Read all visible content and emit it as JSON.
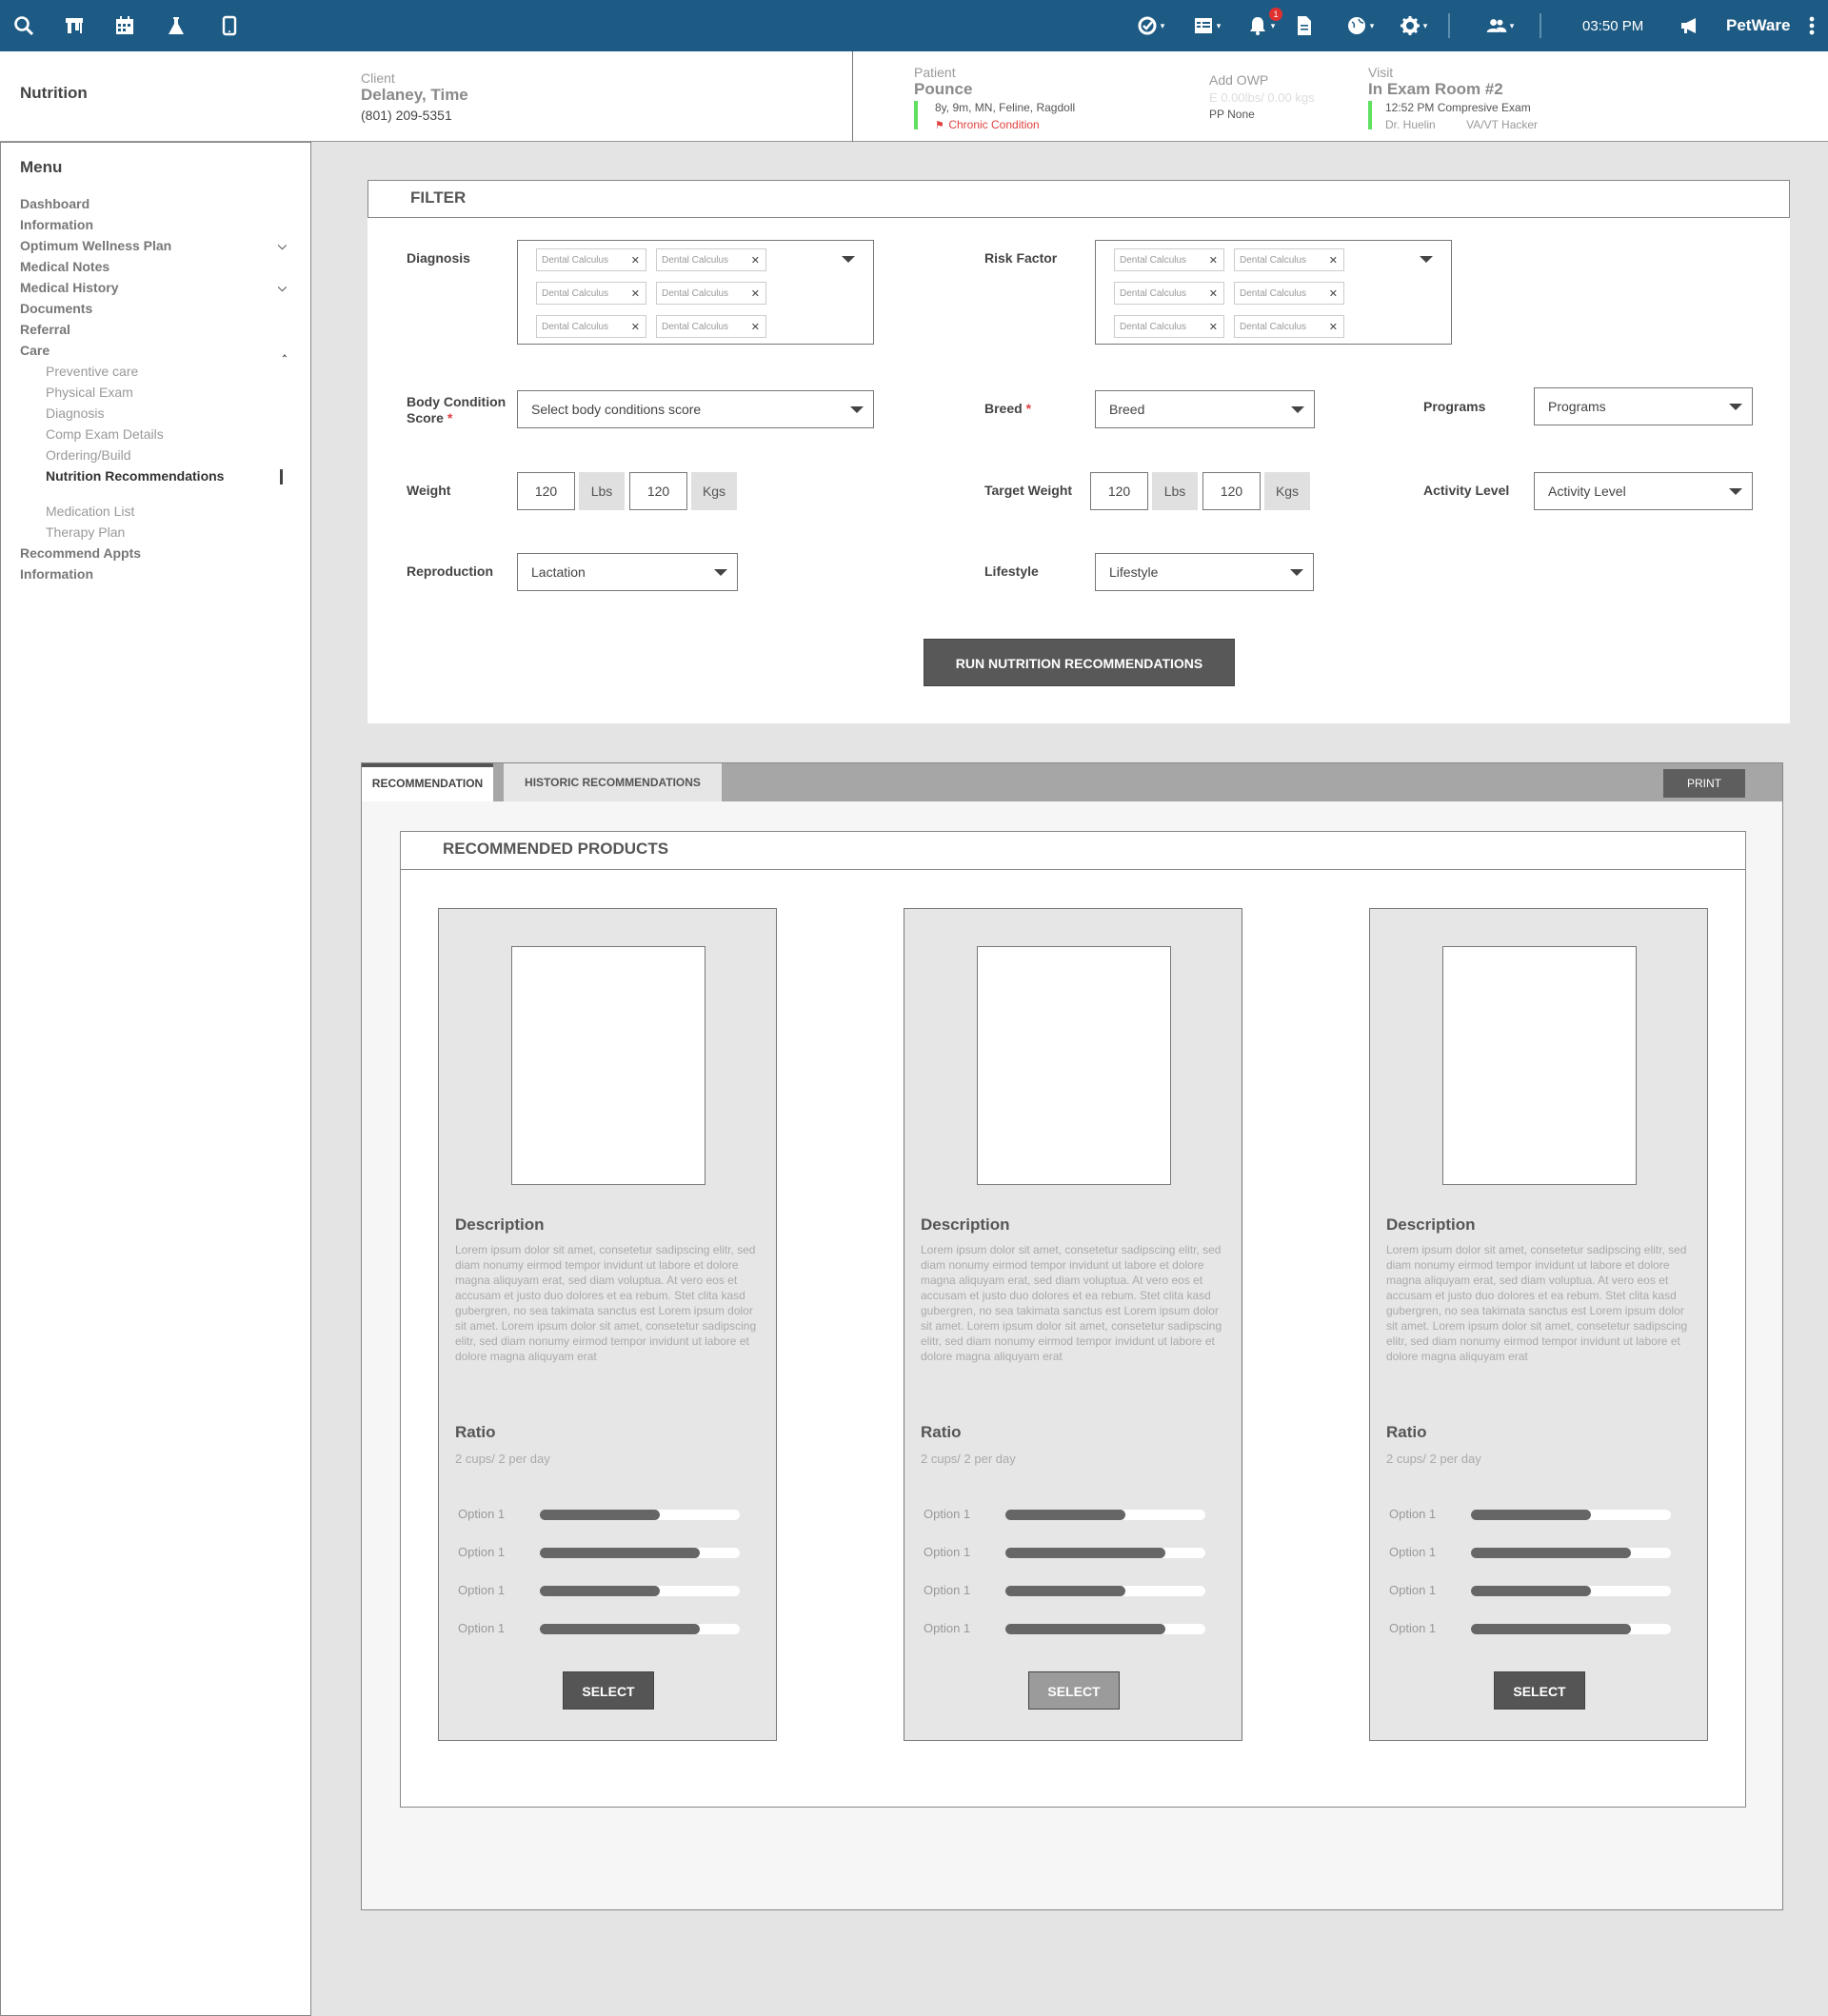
{
  "topbar": {
    "time": "03:50 PM",
    "brand": "PetWare",
    "notification_count": "1"
  },
  "header": {
    "page_title": "Nutrition",
    "client": {
      "label": "Client",
      "name": "Delaney, Time",
      "phone": "(801) 209-5351"
    },
    "patient": {
      "label": "Patient",
      "name": "Pounce",
      "details": "8y, 9m, MN, Feline, Ragdoll",
      "condition": "Chronic Condition"
    },
    "owp": {
      "label": "Add OWP",
      "weight": "E 0.00lbs/ 0.00 kgs",
      "pp": "PP None"
    },
    "visit": {
      "label": "Visit",
      "room": "In Exam Room #2",
      "exam": "12:52 PM Compresive Exam",
      "doctor": "Dr. Huelin",
      "tech": "VA/VT Hacker"
    }
  },
  "sidebar": {
    "title": "Menu",
    "items": [
      {
        "label": "Dashboard"
      },
      {
        "label": "Information"
      },
      {
        "label": "Optimum Wellness Plan"
      },
      {
        "label": "Medical Notes"
      },
      {
        "label": "Medical History"
      },
      {
        "label": "Documents"
      },
      {
        "label": "Referral"
      },
      {
        "label": "Care"
      },
      {
        "label": "Preventive care"
      },
      {
        "label": "Physical Exam"
      },
      {
        "label": "Diagnosis"
      },
      {
        "label": "Comp Exam Details"
      },
      {
        "label": "Ordering/Build"
      },
      {
        "label": "Nutrition Recommendations"
      },
      {
        "label": "Medication List"
      },
      {
        "label": "Therapy Plan"
      },
      {
        "label": "Recommend Appts"
      },
      {
        "label": "Information"
      }
    ]
  },
  "filter": {
    "title": "FILTER",
    "diagnosis": {
      "label": "Diagnosis",
      "tags": [
        "Dental Calculus",
        "Dental Calculus",
        "Dental Calculus",
        "Dental Calculus",
        "Dental Calculus",
        "Dental Calculus"
      ]
    },
    "risk_factor": {
      "label": "Risk Factor",
      "tags": [
        "Dental Calculus",
        "Dental Calculus",
        "Dental Calculus",
        "Dental Calculus",
        "Dental Calculus",
        "Dental Calculus"
      ]
    },
    "body_condition": {
      "label_line1": "Body Condition",
      "label_line2": "Score",
      "placeholder": "Select body conditions score"
    },
    "breed": {
      "label": "Breed",
      "value": "Breed"
    },
    "programs": {
      "label": "Programs",
      "value": "Programs"
    },
    "weight": {
      "label": "Weight",
      "lbs": "120",
      "lbs_unit": "Lbs",
      "kgs": "120",
      "kgs_unit": "Kgs"
    },
    "target_weight": {
      "label": "Target Weight",
      "lbs": "120",
      "lbs_unit": "Lbs",
      "kgs": "120",
      "kgs_unit": "Kgs"
    },
    "activity_level": {
      "label": "Activity Level",
      "value": "Activity Level"
    },
    "reproduction": {
      "label": "Reproduction",
      "value": "Lactation"
    },
    "lifestyle": {
      "label": "Lifestyle",
      "value": "Lifestyle"
    },
    "run_button": "RUN NUTRITION RECOMMENDATIONS"
  },
  "recommendations": {
    "tabs": [
      "RECOMMENDATION",
      "HISTORIC RECOMMENDATIONS"
    ],
    "print_label": "PRINT",
    "section_title": "RECOMMENDED PRODUCTS",
    "products": [
      {
        "description_title": "Description",
        "description": "Lorem ipsum dolor sit amet, consetetur sadipscing elitr, sed diam nonumy eirmod tempor invidunt ut labore et dolore magna aliquyam erat, sed diam voluptua. At vero eos et accusam et justo duo dolores et ea rebum. Stet clita kasd gubergren, no sea takimata sanctus est Lorem ipsum dolor sit amet. Lorem ipsum dolor sit amet, consetetur sadipscing elitr, sed diam nonumy eirmod tempor invidunt ut labore et dolore magna aliquyam erat",
        "ratio_title": "Ratio",
        "ratio": "2 cups/ 2 per day",
        "options": [
          {
            "label": "Option 1",
            "level": 0.6
          },
          {
            "label": "Option 1",
            "level": 0.8
          },
          {
            "label": "Option 1",
            "level": 0.6
          },
          {
            "label": "Option 1",
            "level": 0.8
          }
        ],
        "select_label": "SELECT",
        "select_color": "#555555"
      },
      {
        "description_title": "Description",
        "description": "Lorem ipsum dolor sit amet, consetetur sadipscing elitr, sed diam nonumy eirmod tempor invidunt ut labore et dolore magna aliquyam erat, sed diam voluptua. At vero eos et accusam et justo duo dolores et ea rebum. Stet clita kasd gubergren, no sea takimata sanctus est Lorem ipsum dolor sit amet. Lorem ipsum dolor sit amet, consetetur sadipscing elitr, sed diam nonumy eirmod tempor invidunt ut labore et dolore magna aliquyam erat",
        "ratio_title": "Ratio",
        "ratio": "2 cups/ 2 per day",
        "options": [
          {
            "label": "Option 1",
            "level": 0.6
          },
          {
            "label": "Option 1",
            "level": 0.8
          },
          {
            "label": "Option 1",
            "level": 0.6
          },
          {
            "label": "Option 1",
            "level": 0.8
          }
        ],
        "select_label": "SELECT",
        "select_color": "#9b9b9b"
      },
      {
        "description_title": "Description",
        "description": "Lorem ipsum dolor sit amet, consetetur sadipscing elitr, sed diam nonumy eirmod tempor invidunt ut labore et dolore magna aliquyam erat, sed diam voluptua. At vero eos et accusam et justo duo dolores et ea rebum. Stet clita kasd gubergren, no sea takimata sanctus est Lorem ipsum dolor sit amet. Lorem ipsum dolor sit amet, consetetur sadipscing elitr, sed diam nonumy eirmod tempor invidunt ut labore et dolore magna aliquyam erat",
        "ratio_title": "Ratio",
        "ratio": "2 cups/ 2 per day",
        "options": [
          {
            "label": "Option 1",
            "level": 0.6
          },
          {
            "label": "Option 1",
            "level": 0.8
          },
          {
            "label": "Option 1",
            "level": 0.6
          },
          {
            "label": "Option 1",
            "level": 0.8
          }
        ],
        "select_label": "SELECT",
        "select_color": "#555555"
      }
    ]
  },
  "colors": {
    "topbar": "#1d5b84",
    "accent_green": "#5fe05f",
    "alert_red": "#e04040"
  }
}
